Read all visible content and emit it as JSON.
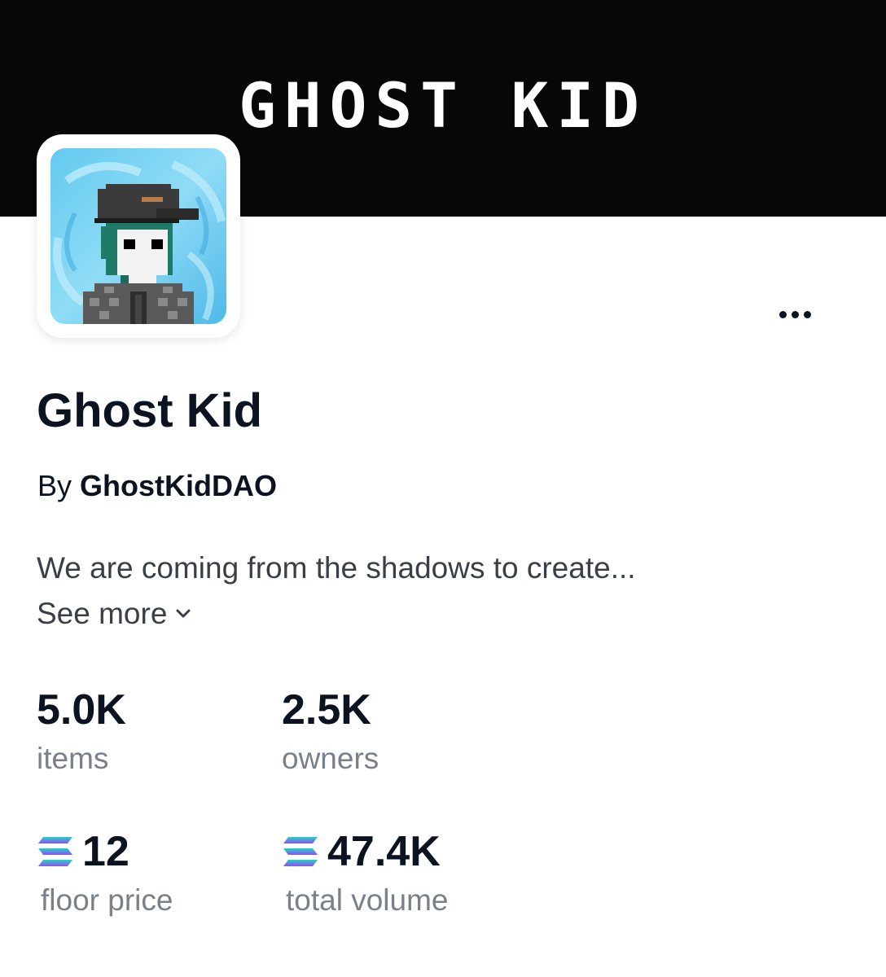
{
  "banner": {
    "title": "GHOST KID"
  },
  "collection": {
    "name": "Ghost Kid",
    "by_label": "By",
    "creator": "GhostKidDAO",
    "description": "We are coming from the shadows to create...",
    "see_more_label": "See more"
  },
  "stats": {
    "items": {
      "value": "5.0K",
      "label": "items"
    },
    "owners": {
      "value": "2.5K",
      "label": "owners"
    },
    "floor_price": {
      "value": "12",
      "label": "floor price",
      "currency_icon": "solana-icon"
    },
    "total_volume": {
      "value": "47.4K",
      "label": "total volume",
      "currency_icon": "solana-icon"
    }
  },
  "icons": {
    "more": "more-horizontal-icon",
    "chevron": "chevron-down-icon"
  },
  "colors": {
    "banner_bg": "#070707",
    "text_primary": "#0b1220",
    "text_secondary": "#7a8089",
    "sol_gradient_top": "#27d3c2",
    "sol_gradient_bottom": "#9945ff"
  }
}
